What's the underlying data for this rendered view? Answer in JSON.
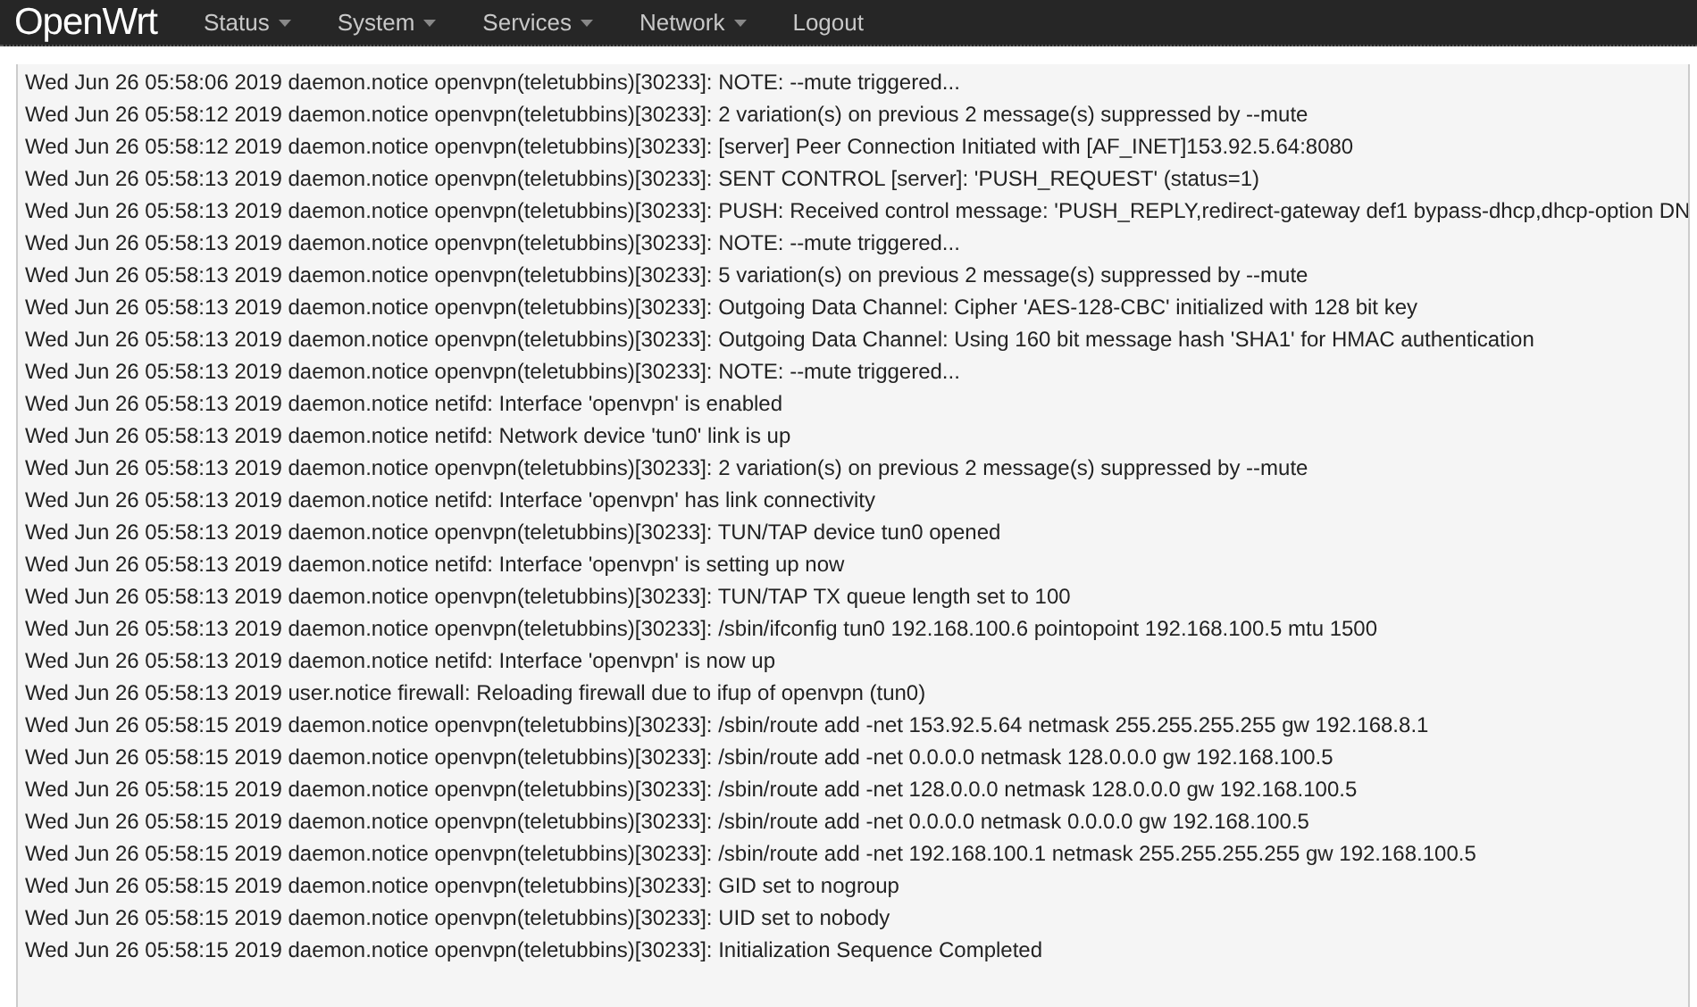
{
  "navbar": {
    "brand": "OpenWrt",
    "menu": [
      {
        "label": "Status",
        "dropdown": true
      },
      {
        "label": "System",
        "dropdown": true
      },
      {
        "label": "Services",
        "dropdown": true
      },
      {
        "label": "Network",
        "dropdown": true
      },
      {
        "label": "Logout",
        "dropdown": false
      }
    ]
  },
  "log_lines": [
    "Wed Jun 26 05:58:06 2019 daemon.notice openvpn(teletubbins)[30233]: NOTE: --mute triggered...",
    "Wed Jun 26 05:58:12 2019 daemon.notice openvpn(teletubbins)[30233]: 2 variation(s) on previous 2 message(s) suppressed by --mute",
    "Wed Jun 26 05:58:12 2019 daemon.notice openvpn(teletubbins)[30233]: [server] Peer Connection Initiated with [AF_INET]153.92.5.64:8080",
    "Wed Jun 26 05:58:13 2019 daemon.notice openvpn(teletubbins)[30233]: SENT CONTROL [server]: 'PUSH_REQUEST' (status=1)",
    "Wed Jun 26 05:58:13 2019 daemon.notice openvpn(teletubbins)[30233]: PUSH: Received control message: 'PUSH_REPLY,redirect-gateway def1 bypass-dhcp,dhcp-option DN",
    "Wed Jun 26 05:58:13 2019 daemon.notice openvpn(teletubbins)[30233]: NOTE: --mute triggered...",
    "Wed Jun 26 05:58:13 2019 daemon.notice openvpn(teletubbins)[30233]: 5 variation(s) on previous 2 message(s) suppressed by --mute",
    "Wed Jun 26 05:58:13 2019 daemon.notice openvpn(teletubbins)[30233]: Outgoing Data Channel: Cipher 'AES-128-CBC' initialized with 128 bit key",
    "Wed Jun 26 05:58:13 2019 daemon.notice openvpn(teletubbins)[30233]: Outgoing Data Channel: Using 160 bit message hash 'SHA1' for HMAC authentication",
    "Wed Jun 26 05:58:13 2019 daemon.notice openvpn(teletubbins)[30233]: NOTE: --mute triggered...",
    "Wed Jun 26 05:58:13 2019 daemon.notice netifd: Interface 'openvpn' is enabled",
    "Wed Jun 26 05:58:13 2019 daemon.notice netifd: Network device 'tun0' link is up",
    "Wed Jun 26 05:58:13 2019 daemon.notice openvpn(teletubbins)[30233]: 2 variation(s) on previous 2 message(s) suppressed by --mute",
    "Wed Jun 26 05:58:13 2019 daemon.notice netifd: Interface 'openvpn' has link connectivity",
    "Wed Jun 26 05:58:13 2019 daemon.notice openvpn(teletubbins)[30233]: TUN/TAP device tun0 opened",
    "Wed Jun 26 05:58:13 2019 daemon.notice netifd: Interface 'openvpn' is setting up now",
    "Wed Jun 26 05:58:13 2019 daemon.notice openvpn(teletubbins)[30233]: TUN/TAP TX queue length set to 100",
    "Wed Jun 26 05:58:13 2019 daemon.notice openvpn(teletubbins)[30233]: /sbin/ifconfig tun0 192.168.100.6 pointopoint 192.168.100.5 mtu 1500",
    "Wed Jun 26 05:58:13 2019 daemon.notice netifd: Interface 'openvpn' is now up",
    "Wed Jun 26 05:58:13 2019 user.notice firewall: Reloading firewall due to ifup of openvpn (tun0)",
    "Wed Jun 26 05:58:15 2019 daemon.notice openvpn(teletubbins)[30233]: /sbin/route add -net 153.92.5.64 netmask 255.255.255.255 gw 192.168.8.1",
    "Wed Jun 26 05:58:15 2019 daemon.notice openvpn(teletubbins)[30233]: /sbin/route add -net 0.0.0.0 netmask 128.0.0.0 gw 192.168.100.5",
    "Wed Jun 26 05:58:15 2019 daemon.notice openvpn(teletubbins)[30233]: /sbin/route add -net 128.0.0.0 netmask 128.0.0.0 gw 192.168.100.5",
    "Wed Jun 26 05:58:15 2019 daemon.notice openvpn(teletubbins)[30233]: /sbin/route add -net 0.0.0.0 netmask 0.0.0.0 gw 192.168.100.5",
    "Wed Jun 26 05:58:15 2019 daemon.notice openvpn(teletubbins)[30233]: /sbin/route add -net 192.168.100.1 netmask 255.255.255.255 gw 192.168.100.5",
    "Wed Jun 26 05:58:15 2019 daemon.notice openvpn(teletubbins)[30233]: GID set to nogroup",
    "Wed Jun 26 05:58:15 2019 daemon.notice openvpn(teletubbins)[30233]: UID set to nobody",
    "Wed Jun 26 05:58:15 2019 daemon.notice openvpn(teletubbins)[30233]: Initialization Sequence Completed"
  ]
}
